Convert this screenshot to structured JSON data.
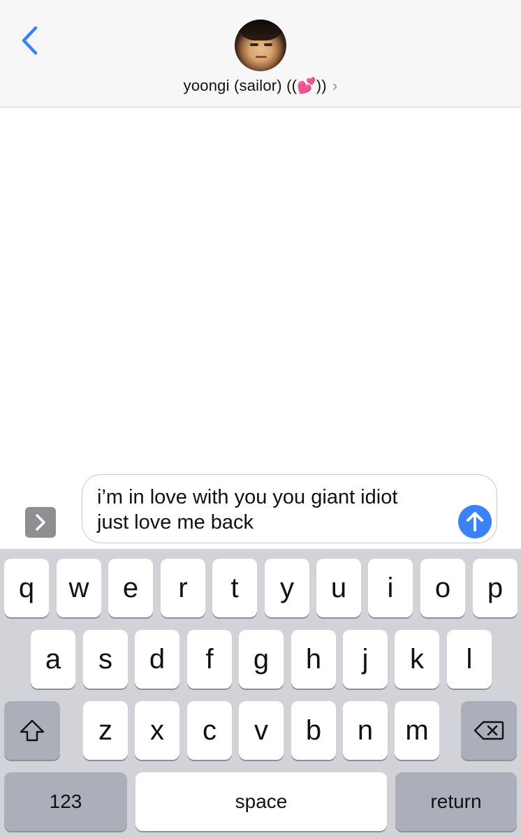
{
  "header": {
    "contact_name": "yoongi (sailor) ((💕))",
    "chevron": "›"
  },
  "icons": {
    "back": "chevron-left-icon",
    "contact_chevron": "chevron-right-icon",
    "expand": "chevron-right-icon",
    "send": "arrow-up-icon",
    "shift": "shift-icon",
    "delete": "backspace-icon"
  },
  "compose": {
    "text": "i’m in love with you you giant idiot\njust love me back"
  },
  "keyboard": {
    "row1": [
      "q",
      "w",
      "e",
      "r",
      "t",
      "y",
      "u",
      "i",
      "o",
      "p"
    ],
    "row2": [
      "a",
      "s",
      "d",
      "f",
      "g",
      "h",
      "j",
      "k",
      "l"
    ],
    "row3": [
      "z",
      "x",
      "c",
      "v",
      "b",
      "n",
      "m"
    ],
    "numbers_label": "123",
    "space_label": "space",
    "return_label": "return"
  },
  "colors": {
    "accent": "#3a82f7",
    "header_bg": "#f7f7f7",
    "keyboard_bg": "#d1d3d9",
    "key_bg": "#ffffff",
    "special_key_bg": "#abafb9"
  }
}
